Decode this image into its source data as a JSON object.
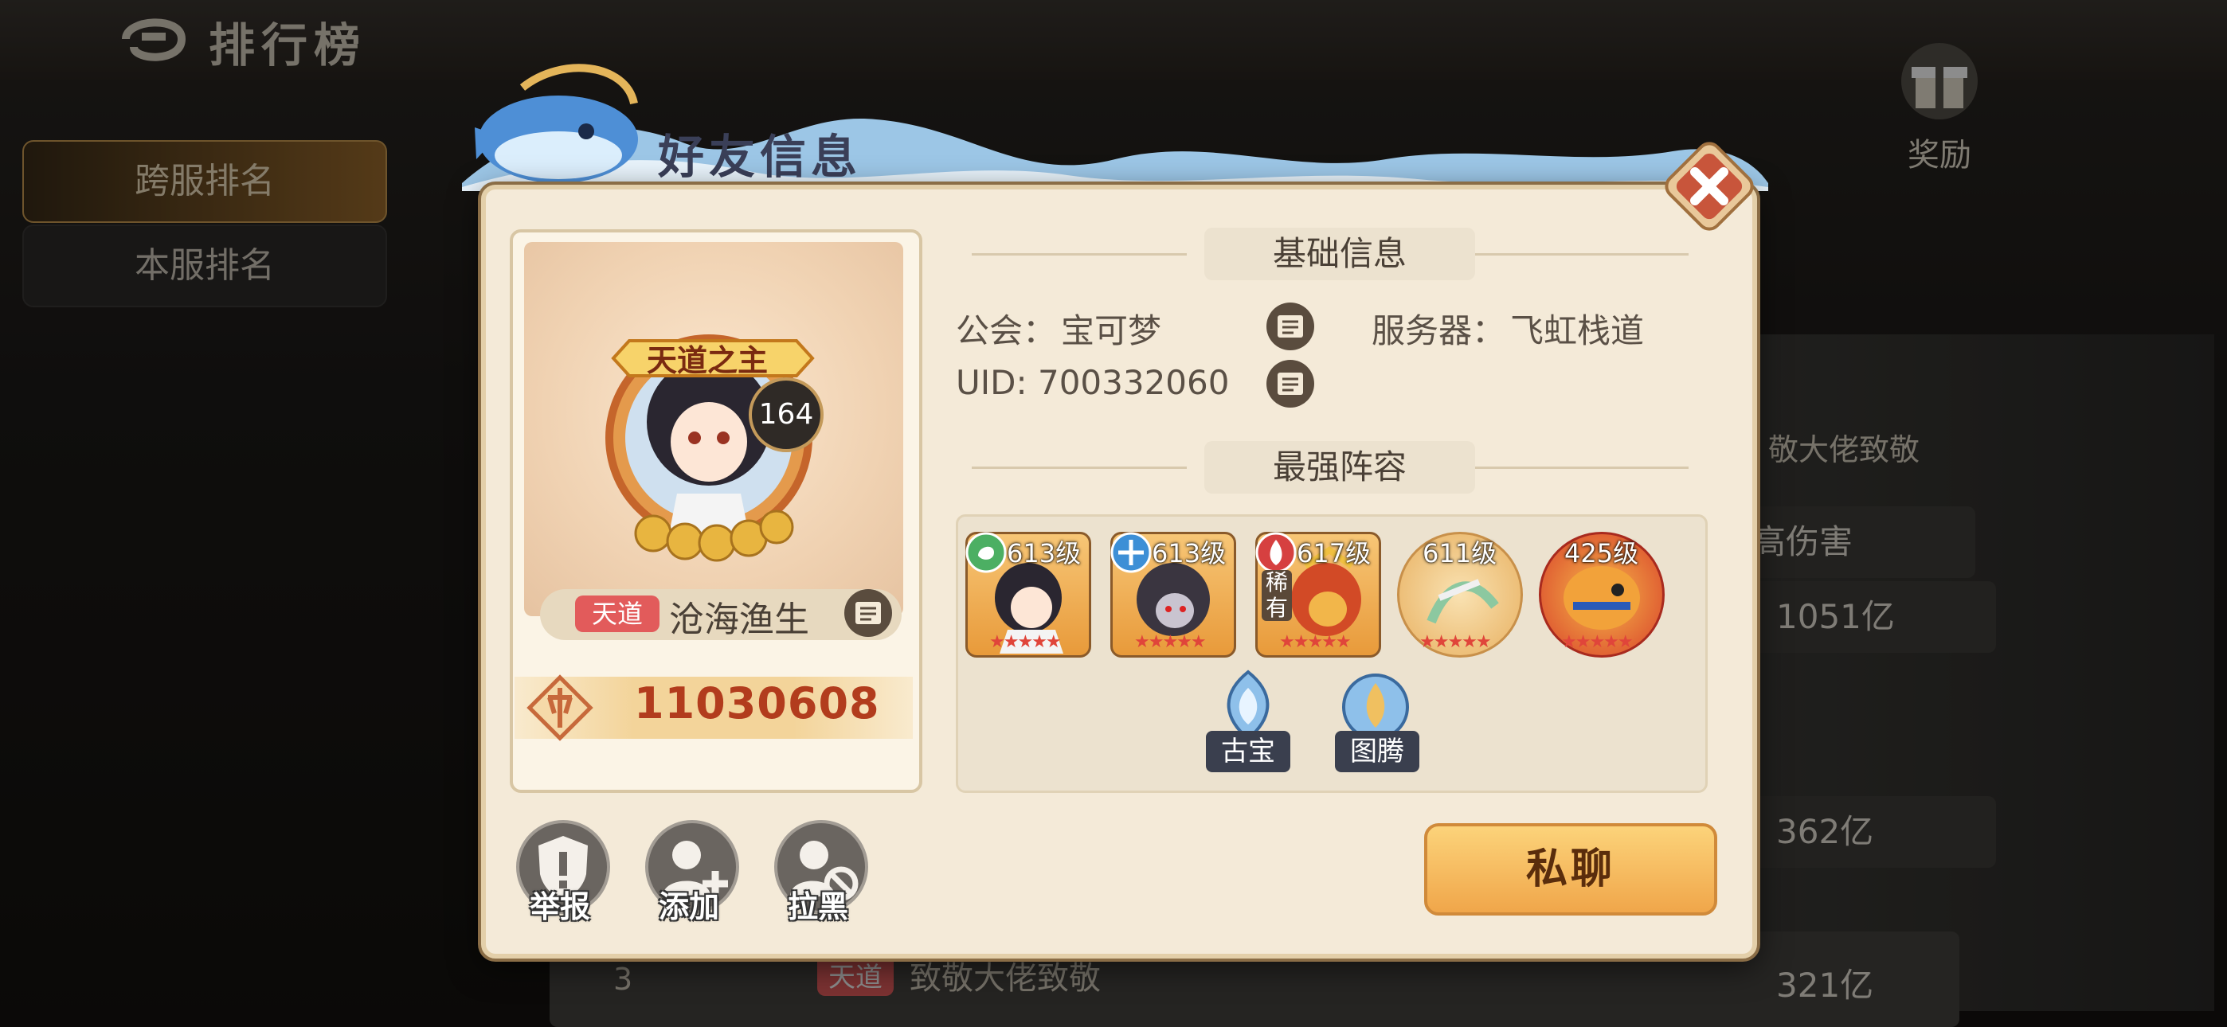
{
  "background": {
    "title": "排行榜",
    "tabs": [
      {
        "label": "跨服排名"
      },
      {
        "label": "本服排名"
      }
    ],
    "reward_label": "奖励",
    "side_texts": {
      "salute": "敬大佬致敬",
      "high_damage": "高伤害",
      "score1": "1051亿",
      "score2": "362亿",
      "score3": "321亿",
      "row3_rank": "3",
      "row3_tag": "天道",
      "row3_name": "致敬大佬致敬"
    }
  },
  "dialog": {
    "title": "好友信息",
    "profile": {
      "title_badge": "天道之主",
      "level": "164",
      "rank_tag": "天道",
      "name": "沧海渔生",
      "power": "11030608"
    },
    "basic_info": {
      "header": "基础信息",
      "guild_label": "公会：",
      "guild_value": "宝可梦",
      "server_label": "服务器：",
      "server_value": "飞虹栈道",
      "uid": "UID: 700332060"
    },
    "lineup": {
      "header": "最强阵容",
      "heroes": [
        {
          "level": "613级",
          "element_icon": "leaf-element-icon",
          "stars": "★★★★★"
        },
        {
          "level": "613级",
          "element_icon": "cross-element-icon",
          "stars": "★★★★★"
        },
        {
          "level": "617级",
          "element_icon": "fire-element-icon",
          "stars": "★★★★★",
          "tag": "稀有"
        },
        {
          "level": "611级",
          "stars": "★★★★★"
        },
        {
          "level": "425级",
          "stars": "★★★★★"
        }
      ],
      "artifacts": [
        {
          "label": "古宝"
        },
        {
          "label": "图腾"
        }
      ]
    },
    "actions": [
      {
        "label": "举报"
      },
      {
        "label": "添加"
      },
      {
        "label": "拉黑"
      }
    ],
    "chat_button": "私聊"
  },
  "colors": {
    "accent_orange": "#f0a64a",
    "power_red": "#b23c1d",
    "rank_tag": "#e25b5b"
  }
}
